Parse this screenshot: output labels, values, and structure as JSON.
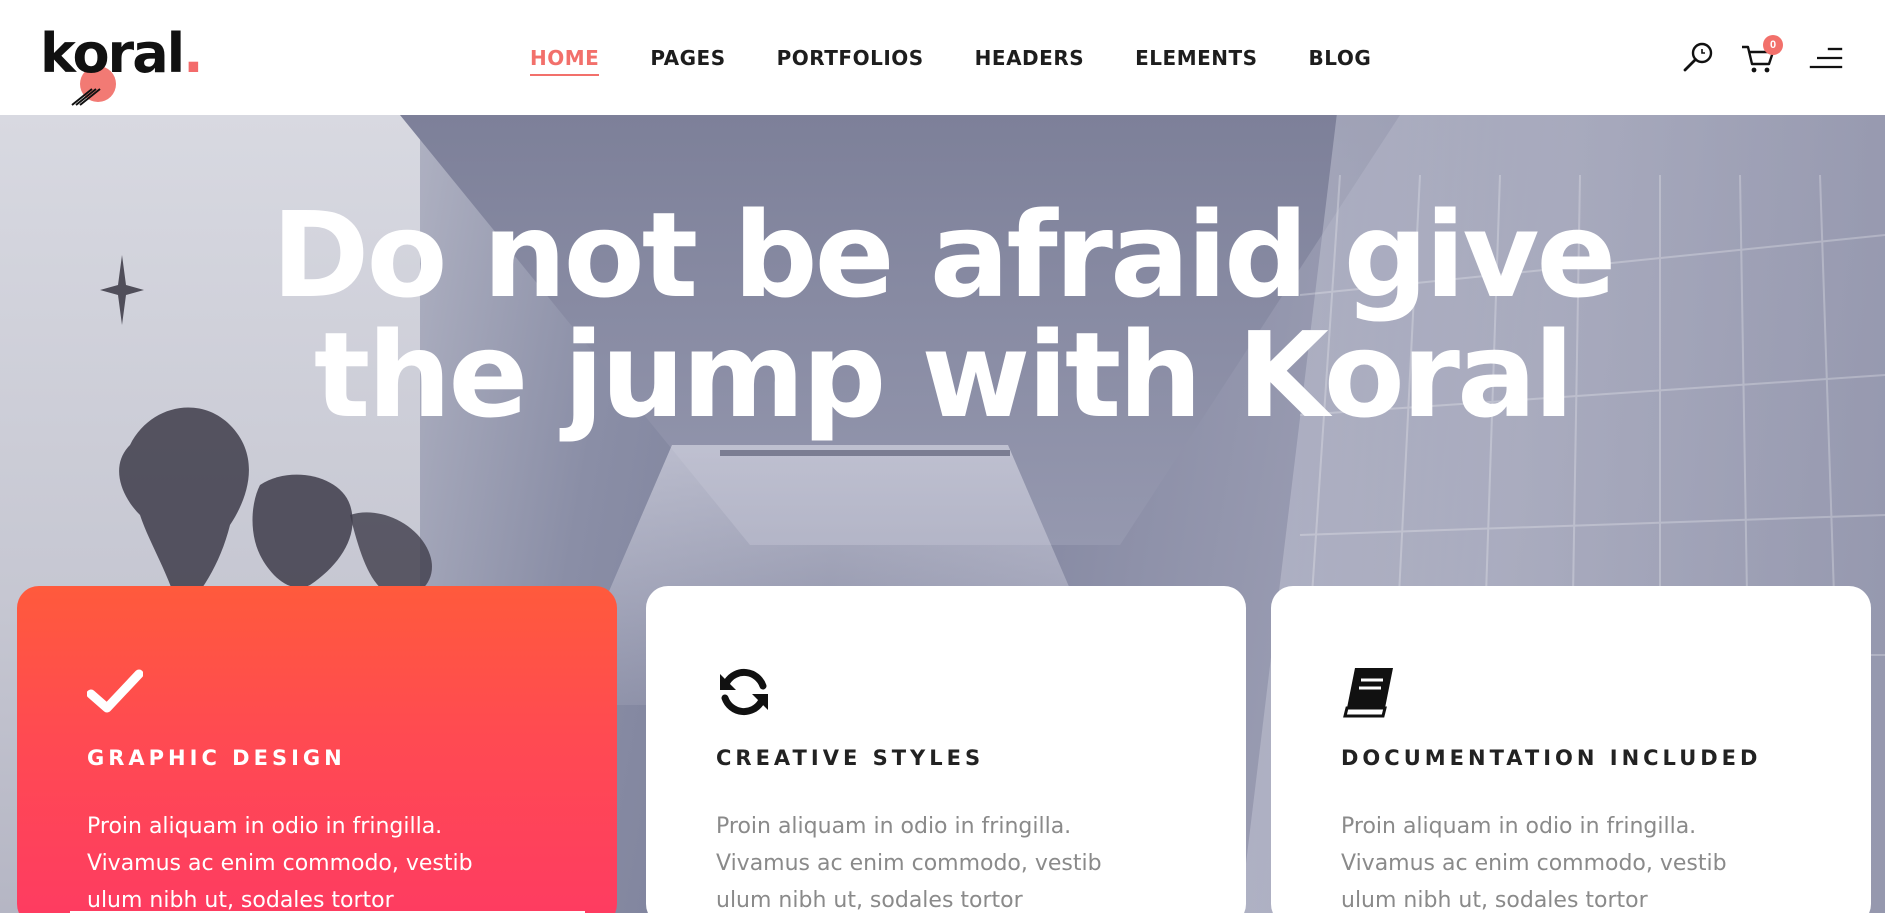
{
  "brand": {
    "logo_text": "koral",
    "logo_dot": ".",
    "accent_color": "#f2706b"
  },
  "nav": {
    "items": [
      {
        "label": "HOME",
        "active": true
      },
      {
        "label": "PAGES",
        "active": false
      },
      {
        "label": "PORTFOLIOS",
        "active": false
      },
      {
        "label": "HEADERS",
        "active": false
      },
      {
        "label": "ELEMENTS",
        "active": false
      },
      {
        "label": "BLOG",
        "active": false
      }
    ]
  },
  "header_icons": {
    "search": "search-icon",
    "cart": "cart-icon",
    "cart_count": "0",
    "menu": "menu-icon"
  },
  "hero": {
    "title_line1": "Do not be afraid give",
    "title_line2": "the jump with Koral"
  },
  "cards": [
    {
      "icon": "checkmark-icon",
      "title": "GRAPHIC DESIGN",
      "text": "Proin aliquam in odio in fringilla. Vivamus ac enim commodo, vestib ulum nibh ut, sodales tortor",
      "style": "gradient",
      "colors": [
        "#ff5a3c",
        "#fe3b62"
      ]
    },
    {
      "icon": "refresh-icon",
      "title": "CREATIVE STYLES",
      "text": "Proin aliquam in odio in fringilla. Vivamus ac enim commodo, vestib ulum nibh ut, sodales tortor",
      "style": "white"
    },
    {
      "icon": "book-icon",
      "title": "DOCUMENTATION INCLUDED",
      "text": "Proin aliquam in odio in fringilla. Vivamus ac enim commodo, vestib ulum nibh ut, sodales tortor",
      "style": "white"
    }
  ]
}
